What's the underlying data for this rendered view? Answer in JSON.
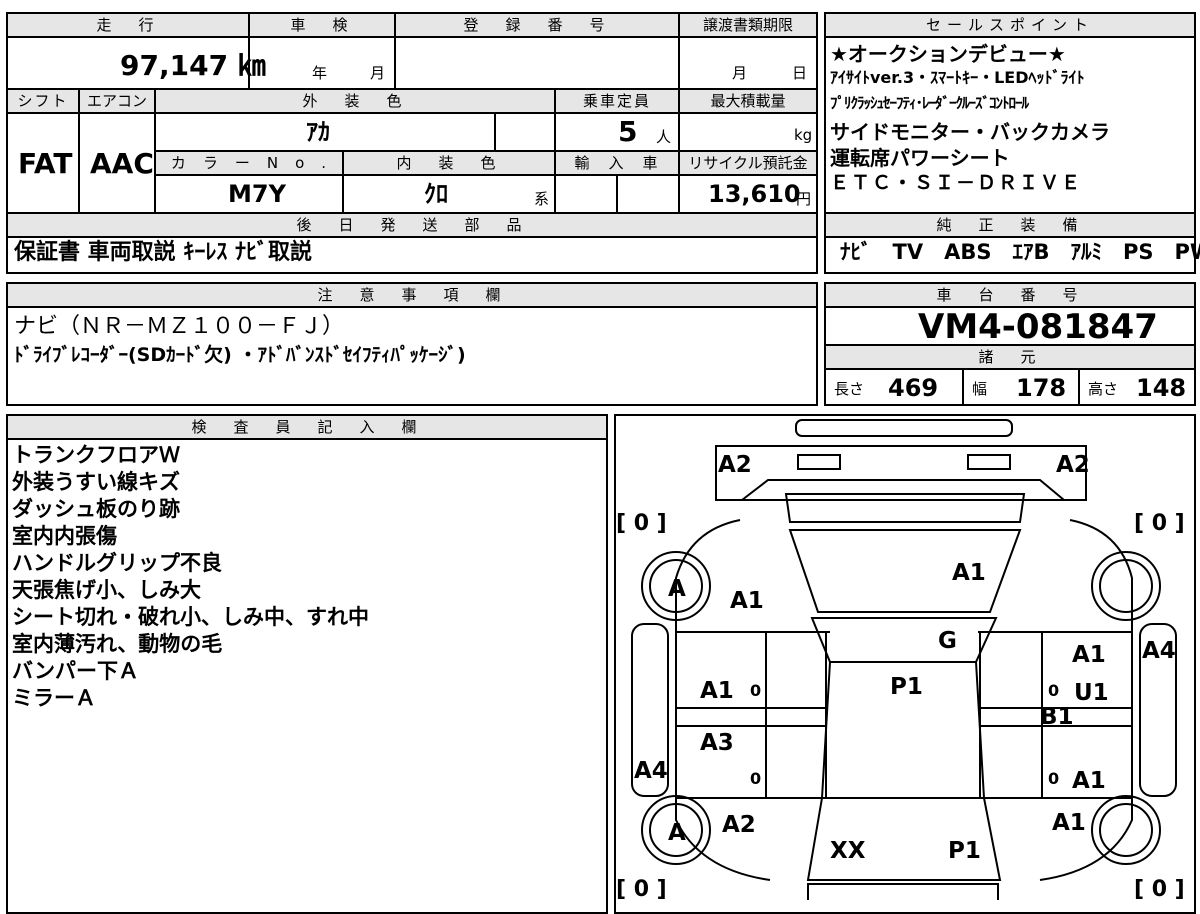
{
  "headers": {
    "mileage": "走　行",
    "inspection": "車　検",
    "registration": "登　録　番　号",
    "transfer_deadline": "譲渡書類期限",
    "sales_points": "セールスポイント",
    "shift": "シフト",
    "aircon": "エアコン",
    "exterior_color": "外　装　色",
    "capacity": "乗車定員",
    "max_load": "最大積載量",
    "color_no": "カ　ラ　ー　N　o　.",
    "interior_color": "内　装　色",
    "import": "輸　入　車",
    "recycle": "リサイクル預託金",
    "later_parts": "後　日　発　送　部　品",
    "genuine_equipment": "純　正　装　備",
    "notes": "注　意　事　項　欄",
    "chassis_no": "車　台　番　号",
    "specs": "諸　元",
    "inspector": "検　査　員　記　入　欄"
  },
  "values": {
    "mileage": "97,147 ㎞",
    "inspection_year": "年",
    "inspection_month": "月",
    "transfer_month": "月",
    "transfer_day": "日",
    "shift": "FAT",
    "aircon": "AAC",
    "exterior_color": "ｱｶ",
    "capacity": "5",
    "capacity_unit": "人",
    "max_load_unit": "kg",
    "color_no": "M7Y",
    "interior_color": "ｸﾛ",
    "interior_suffix": "系",
    "recycle_fee": "13,610",
    "recycle_unit": "円",
    "chassis_no": "VM4-081847"
  },
  "sales_points": [
    "★オークションデビュー★",
    "ｱｲｻｲﾄver.3・ｽﾏｰﾄｷｰ・LEDﾍｯﾄﾞﾗｲﾄ",
    "ﾌﾟﾘｸﾗｯｼｭｾｰﾌﾃｨ･ﾚｰﾀﾞｰｸﾙｰｽﾞｺﾝﾄﾛｰﾙ",
    "サイドモニター・バックカメラ",
    "運転席パワーシート",
    "ＥＴＣ・ＳＩ－ＤＲＩＶＥ"
  ],
  "later_parts": "保証書 車両取説 ｷｰﾚｽ ﾅﾋﾞ取説",
  "genuine_equipment": "ﾅﾋﾞ　TV　ABS　ｴｱB　ｱﾙﾐ　PS　PW",
  "notes": [
    "ナビ（ＮＲ－ＭＺ１００－ＦＪ）",
    "ﾄﾞﾗｲﾌﾞﾚｺｰﾀﾞｰ(SDｶｰﾄﾞ欠) ・ｱﾄﾞﾊﾞﾝｽﾄﾞｾｲﾌﾃｨﾊﾟｯｹｰｼﾞ)"
  ],
  "specs": {
    "length_label": "長さ",
    "length": "469",
    "width_label": "幅",
    "width": "178",
    "height_label": "高さ",
    "height": "148"
  },
  "inspector_notes": [
    "トランクフロアＷ",
    "外装うすい線キズ",
    "ダッシュ板のり跡",
    "室内内張傷",
    "ハンドルグリップ不良",
    "天張焦げ小、しみ大",
    "シート切れ・破れ小、しみ中、すれ中",
    "室内薄汚れ、動物の毛",
    "バンパー下Ａ",
    "ミラーＡ"
  ],
  "diagram": {
    "tread_left_top": "[ 0 ]",
    "tread_right_top": "[ 0 ]",
    "tread_left_bottom": "[ 0 ]",
    "tread_right_bottom": "[ 0 ]",
    "marks": [
      "A2",
      "A2",
      "A1",
      "A1",
      "G",
      "A",
      "A",
      "A1",
      "P1",
      "A1",
      "U1",
      "B1",
      "A3",
      "A4",
      "A4",
      "A1",
      "A2",
      "A1",
      "XX",
      "P1",
      "0",
      "0",
      "0",
      "0"
    ]
  }
}
